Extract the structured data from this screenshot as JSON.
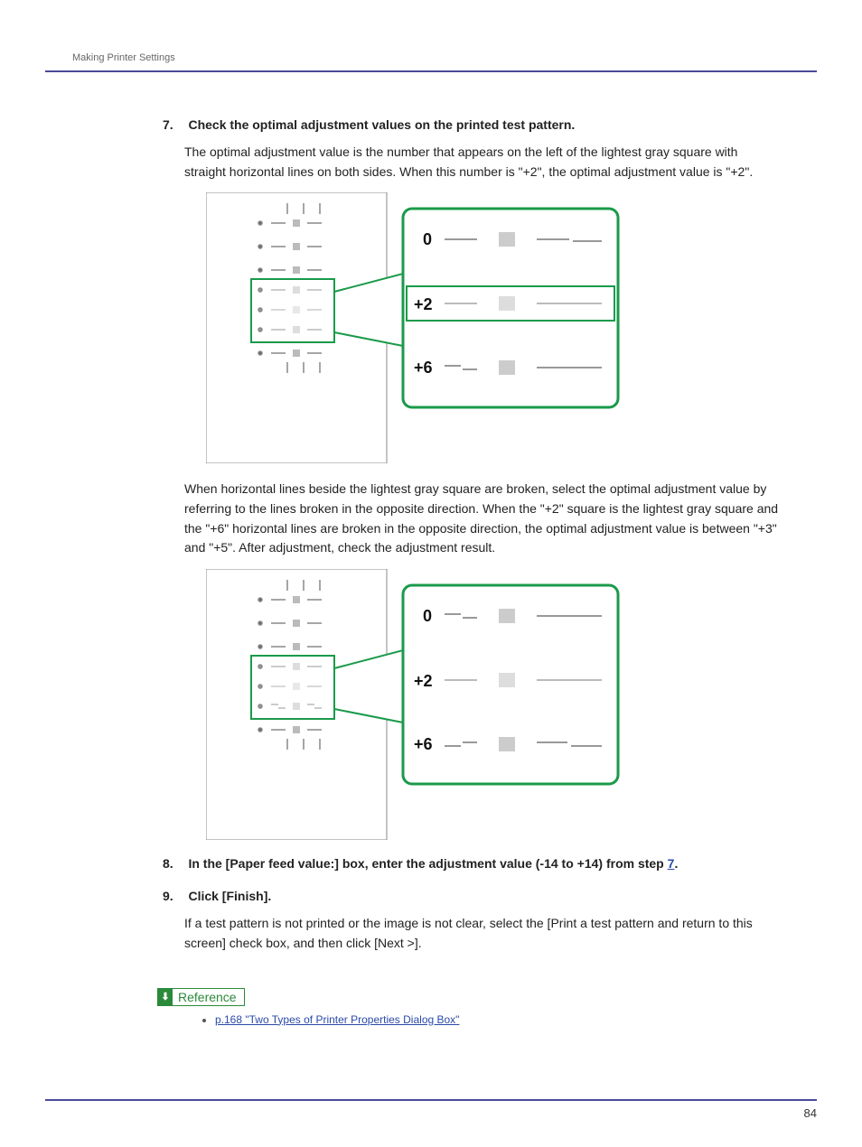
{
  "header": {
    "breadcrumb": "Making Printer Settings"
  },
  "steps": {
    "s7": {
      "num": "7.",
      "title": "Check the optimal adjustment values on the printed test pattern.",
      "p1": "The optimal adjustment value is the number that appears on the left of the lightest gray square with straight horizontal lines on both sides. When this number is \"+2\", the optimal adjustment value is \"+2\".",
      "p2": "When horizontal lines beside the lightest gray square are broken, select the optimal adjustment value by referring to the lines broken in the opposite direction. When the \"+2\" square is the lightest gray square and the \"+6\" horizontal lines are broken in the opposite direction, the optimal adjustment value is between \"+3\" and \"+5\". After adjustment, check the adjustment result."
    },
    "s8": {
      "num": "8.",
      "title_a": "In the [Paper feed value:] box, enter the adjustment value (-14 to +14) from step ",
      "title_link": "7",
      "title_b": "."
    },
    "s9": {
      "num": "9.",
      "title": "Click [Finish].",
      "p1": "If a test pattern is not printed or the image is not clear, select the [Print a test pattern and return to this screen] check box, and then click [Next >]."
    }
  },
  "diagram": {
    "labels": {
      "r0": "0",
      "r1": "+2",
      "r2": "+6"
    }
  },
  "reference": {
    "label": "Reference",
    "icon": "⬇",
    "link_text": "p.168 \"Two Types of Printer Properties Dialog Box\""
  },
  "footer": {
    "page_num": "84"
  }
}
